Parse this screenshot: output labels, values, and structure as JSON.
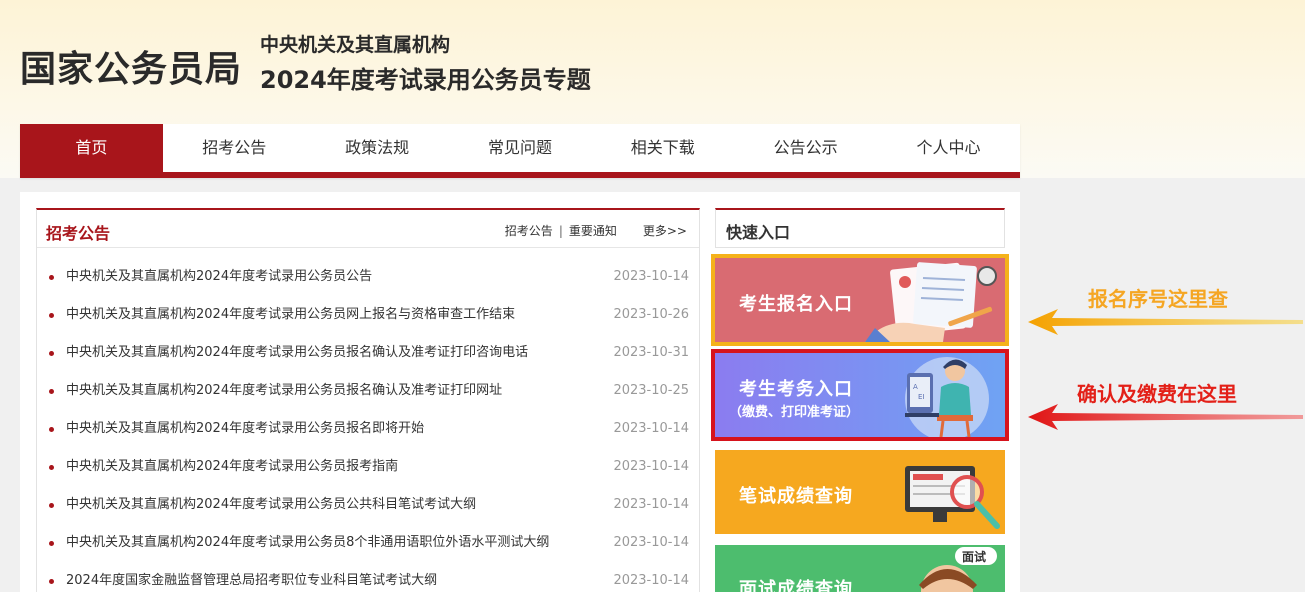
{
  "header": {
    "brand": "国家公务员局",
    "subtitle_line1": "中央机关及其直属机构",
    "subtitle_line2": "2024年度考试录用公务员专题"
  },
  "nav": {
    "items": [
      {
        "label": "首页",
        "active": true
      },
      {
        "label": "招考公告"
      },
      {
        "label": "政策法规"
      },
      {
        "label": "常见问题"
      },
      {
        "label": "相关下载"
      },
      {
        "label": "公告公示"
      },
      {
        "label": "个人中心"
      }
    ]
  },
  "news": {
    "title": "招考公告",
    "link1": "招考公告",
    "sep": "|",
    "link2": "重要通知",
    "more": "更多>>",
    "items": [
      {
        "title": "中央机关及其直属机构2024年度考试录用公务员公告",
        "date": "2023-10-14"
      },
      {
        "title": "中央机关及其直属机构2024年度考试录用公务员网上报名与资格审查工作结束",
        "date": "2023-10-26"
      },
      {
        "title": "中央机关及其直属机构2024年度考试录用公务员报名确认及准考证打印咨询电话",
        "date": "2023-10-31"
      },
      {
        "title": "中央机关及其直属机构2024年度考试录用公务员报名确认及准考证打印网址",
        "date": "2023-10-25"
      },
      {
        "title": "中央机关及其直属机构2024年度考试录用公务员报名即将开始",
        "date": "2023-10-14"
      },
      {
        "title": "中央机关及其直属机构2024年度考试录用公务员报考指南",
        "date": "2023-10-14"
      },
      {
        "title": "中央机关及其直属机构2024年度考试录用公务员公共科目笔试考试大纲",
        "date": "2023-10-14"
      },
      {
        "title": "中央机关及其直属机构2024年度考试录用公务员8个非通用语职位外语水平测试大纲",
        "date": "2023-10-14"
      },
      {
        "title": "2024年度国家金融监督管理总局招考职位专业科目笔试考试大纲",
        "date": "2023-10-14"
      }
    ]
  },
  "quick": {
    "title": "快速入口",
    "card1_label": "考生报名入口",
    "card2_label": "考生考务入口",
    "card2_sub": "（缴费、打印准考证）",
    "card3_label": "笔试成绩查询",
    "card4_label": "面试成绩查询",
    "card4_badge": "面试"
  },
  "annotations": {
    "arrow1_text": "报名序号这里查",
    "arrow2_text": "确认及缴费在这里"
  },
  "colors": {
    "brand_red": "#a8151b",
    "card1": "#d96b72",
    "card2": "#7d8ef2",
    "card3": "#f6a81f",
    "card4": "#4dbd6e",
    "highlight_yellow": "#f5b21a",
    "highlight_red": "#d6131d"
  }
}
